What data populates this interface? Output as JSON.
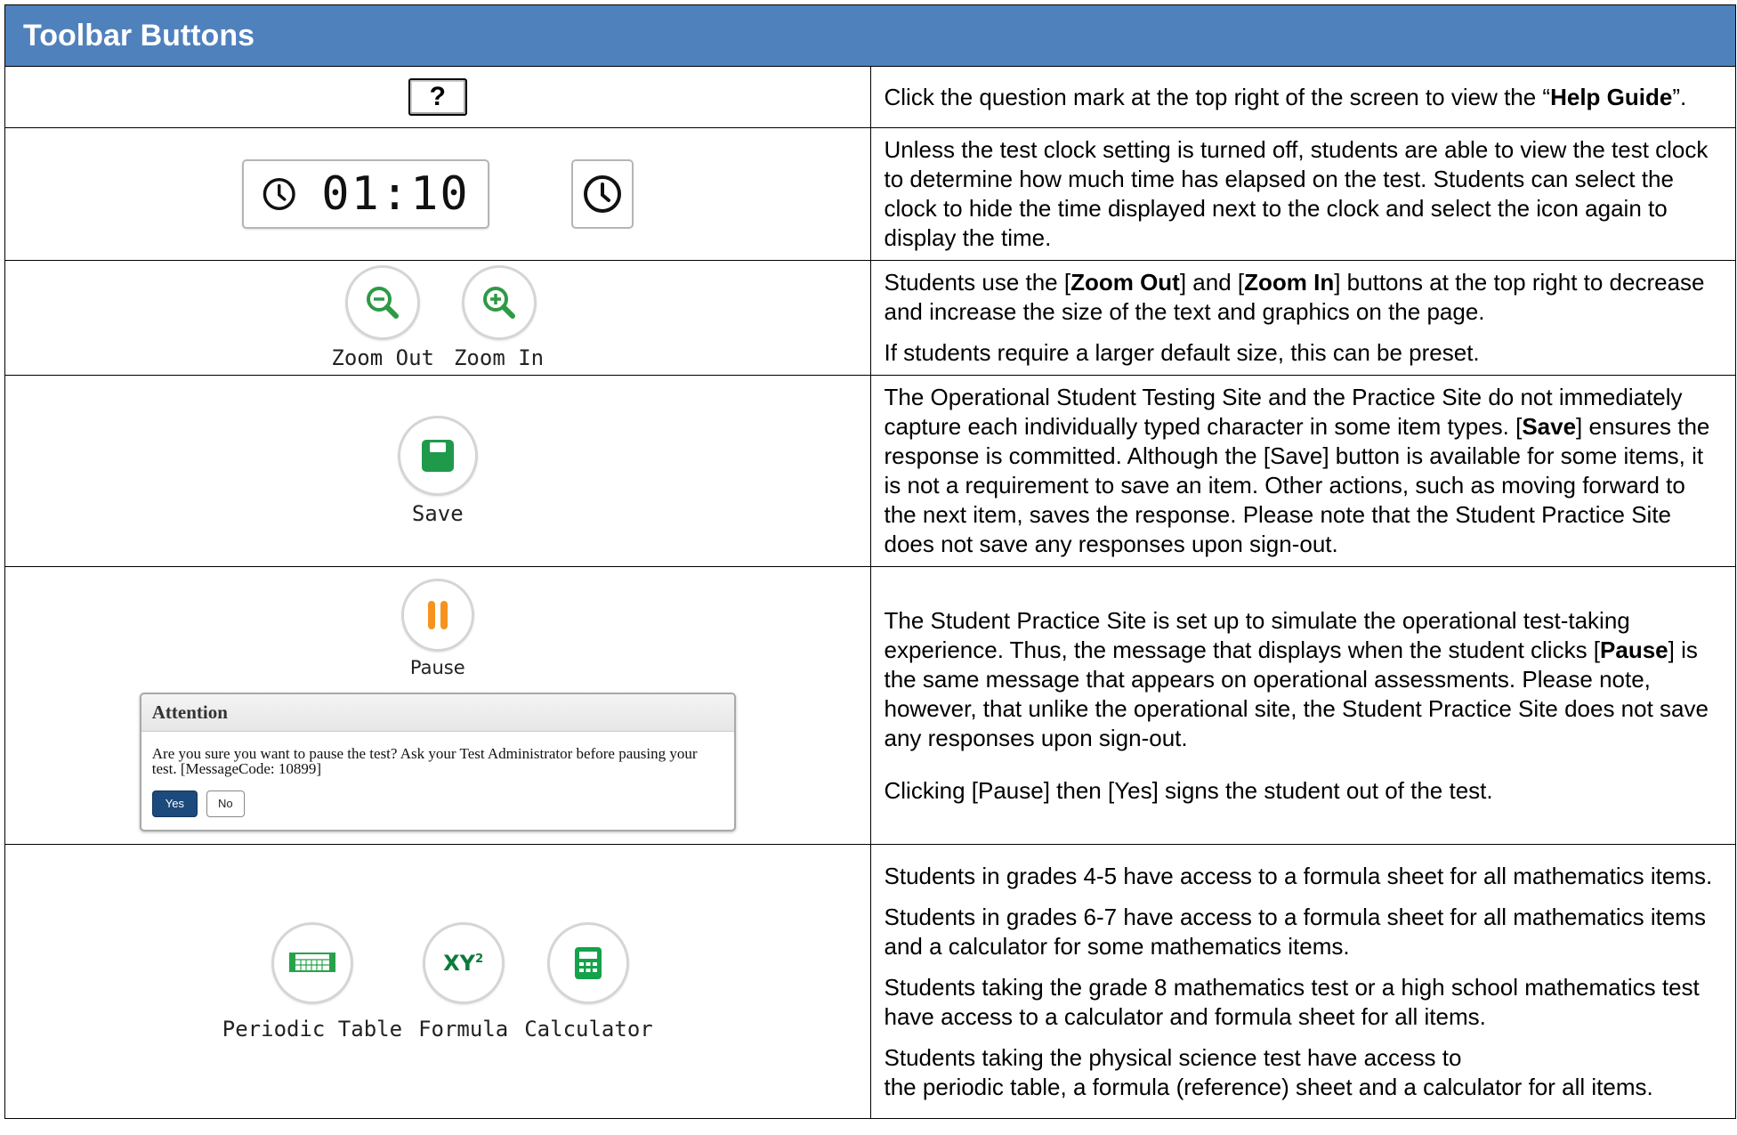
{
  "header": {
    "title": "Toolbar Buttons"
  },
  "rows": {
    "help": {
      "icon_text": "?",
      "desc_pre": "Click the question mark at the top right of the screen to view the “",
      "desc_bold": "Help Guide",
      "desc_post": "”."
    },
    "clock": {
      "time": "01:10",
      "desc": "Unless the test clock setting is turned off, students are able to view the test clock to determine how much time has elapsed on the test. Students can select the clock to hide the time displayed next to the clock and select the icon again to display the time."
    },
    "zoom": {
      "zoom_out_label": "Zoom Out",
      "zoom_in_label": "Zoom In",
      "p1_a": "Students use the [",
      "p1_b": "Zoom Out",
      "p1_c": "] and [",
      "p1_d": "Zoom In",
      "p1_e": "] buttons at the top right to decrease and increase the size of the text and graphics on the page.",
      "p2": "If students require a larger default size, this can be preset."
    },
    "save": {
      "label": "Save",
      "a": "The Operational Student Testing Site and the Practice Site do not immediately capture each individually typed character in some item types. [",
      "b": "Save",
      "c": "] ensures the response is committed. Although the [Save] button is available for some items, it is not a requirement to save an item. Other actions, such as moving forward to the next item, saves the response. Please note that the Student Practice Site does not save any responses upon sign-out."
    },
    "pause": {
      "label": "Pause",
      "dialog_title": "Attention",
      "dialog_text": "Are you sure you want to pause the test? Ask your Test Administrator before pausing your test. [MessageCode: 10899]",
      "yes_label": "Yes",
      "no_label": "No",
      "p1_a": "The Student Practice Site is set up to simulate the operational test-taking experience. Thus, the message that displays when the student clicks [",
      "p1_b": "Pause",
      "p1_c": "] is the same message that appears on operational assessments. Please note, however, that unlike the operational site, the Student Practice Site does not save any responses upon sign-out.",
      "p2": "Clicking [Pause] then [Yes] signs the student out of the test."
    },
    "tools": {
      "periodic_label": "Periodic Table",
      "formula_label": "Formula",
      "formula_icon_text": "XY",
      "formula_icon_sup": "2",
      "calculator_label": "Calculator",
      "p1": "Students in grades 4-5 have access to a formula sheet for all mathematics items.",
      "p2": "Students in grades 6-7 have access to a formula sheet for all mathematics items and a calculator for some mathematics items.",
      "p3": "Students taking the grade 8 mathematics test or a high school mathematics test have access to a calculator and formula sheet for all items.",
      "p4_line1": "Students taking the physical science test have access to",
      "p4_line2": "the periodic table, a formula (reference) sheet and a calculator for all items."
    }
  },
  "colors": {
    "header_bg": "#4f81bd",
    "zoom_green": "#2e9a45",
    "save_green": "#1e9a4a",
    "pause_orange": "#f5931e",
    "dialog_yes": "#1c4a7c"
  }
}
